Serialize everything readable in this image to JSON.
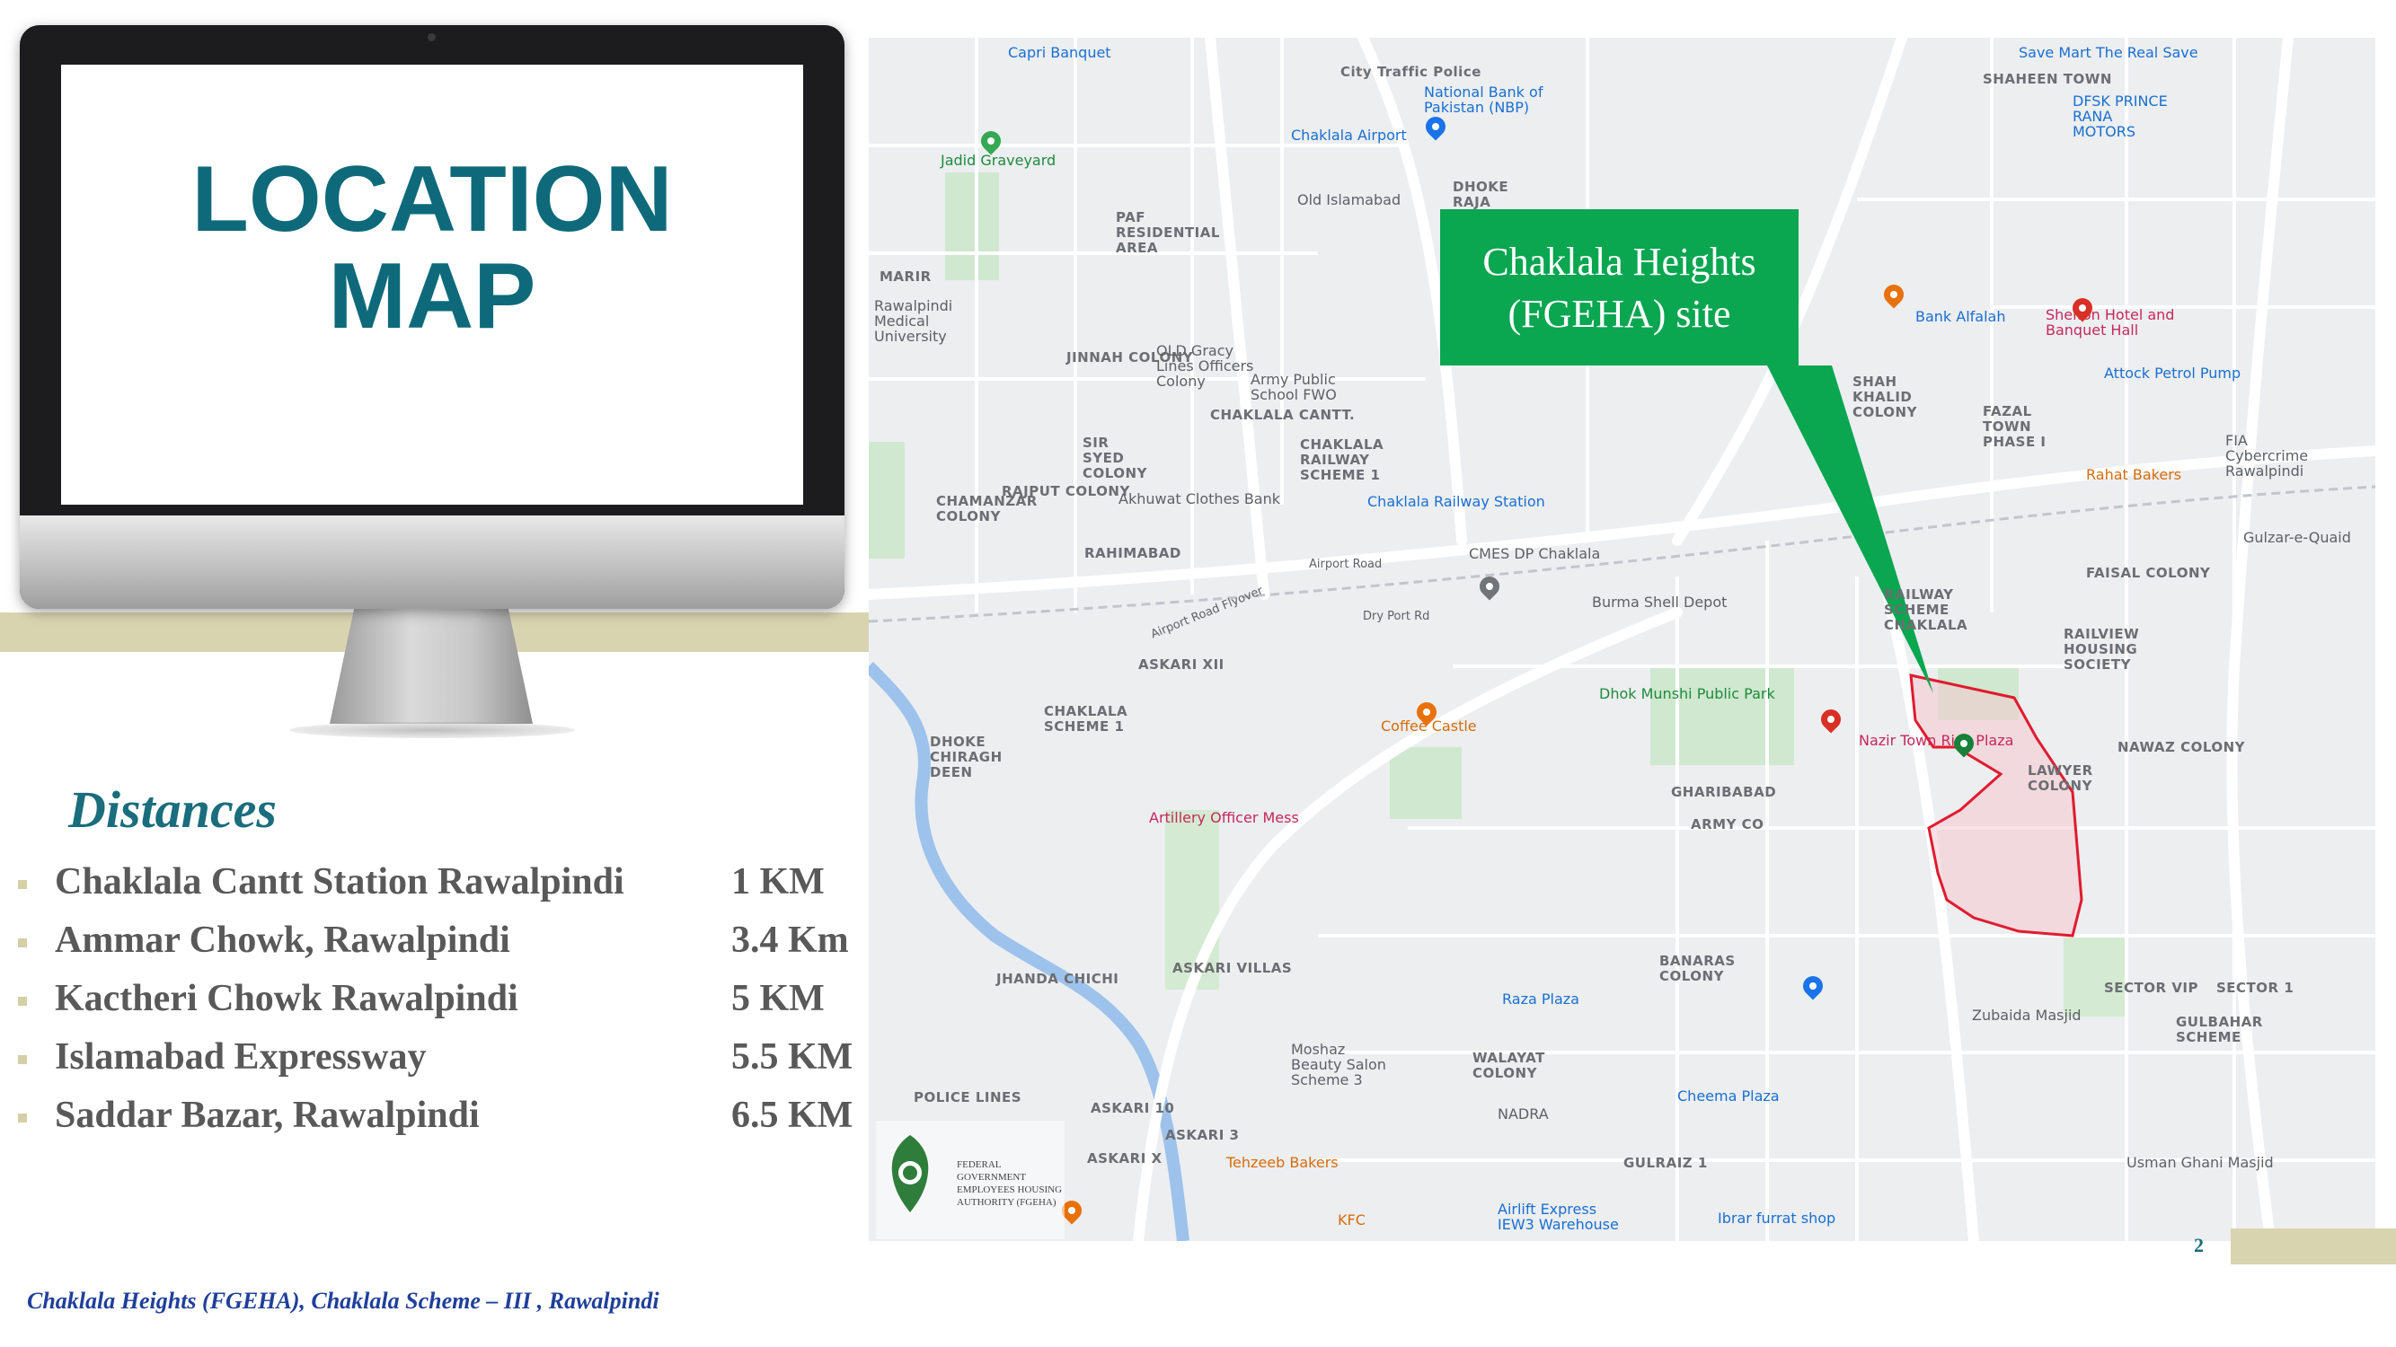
{
  "title_line1": "LOCATION",
  "title_line2": "MAP",
  "distances_heading": "Distances",
  "distances": [
    {
      "place": "Chaklala Cantt Station Rawalpindi",
      "distance": "1 KM"
    },
    {
      "place": "Ammar Chowk, Rawalpindi",
      "distance": "3.4 Km"
    },
    {
      "place": "Kactheri Chowk Rawalpindi",
      "distance": "5 KM"
    },
    {
      "place": "Islamabad Expressway",
      "distance": "5.5 KM"
    },
    {
      "place": "Saddar Bazar, Rawalpindi",
      "distance": "6.5 KM"
    }
  ],
  "footer": "Chaklala Heights (FGEHA), Chaklala Scheme – III , Rawalpindi",
  "page_number": "2",
  "callout": {
    "line1": "Chaklala Heights",
    "line2": "(FGEHA) site"
  },
  "logo_text": "FEDERAL GOVERNMENT EMPLOYEES HOUSING AUTHORITY (FGEHA)",
  "colors": {
    "title": "#0e6a7a",
    "callout": "#0aa650",
    "accent_tan": "#d9d4b0",
    "footer": "#1f3f9a"
  },
  "map_labels": {
    "capri_banquet": "Capri Banquet",
    "city_traffic_police": "City Traffic Police",
    "national_bank": "National Bank of Pakistan (NBP)",
    "save_mart": "Save Mart The Real Save",
    "shaheen_town": "SHAHEEN TOWN",
    "dfsk": "DFSK PRINCE RANA MOTORS",
    "jadid_graveyard": "Jadid Graveyard",
    "chaklala_airport": "Chaklala Airport",
    "old_islamabad": "Old Islamabad",
    "dhoke_raja": "DHOKE RAJA MUHAMMAD",
    "paf_residential": "PAF RESIDENTIAL AREA",
    "marir": "MARIR",
    "rawalpindi_medical": "Rawalpindi Medical University",
    "jinnah_colony": "JINNAH COLONY",
    "old_gracy": "OLD Gracy Lines Officers Colony",
    "army_public_school": "Army Public School FWO",
    "chaklala_cantt": "CHAKLALA CANTT.",
    "chaklala_railway": "CHAKLALA RAILWAY SCHEME 1",
    "bank_alfalah": "Bank Alfalah",
    "shelton": "Shelton Hotel and Banquet Hall",
    "shah_khalid": "SHAH KHALID COLONY",
    "attock_petrol": "Attock Petrol Pump",
    "fazal_town": "FAZAL TOWN PHASE I",
    "sir_syed": "SIR SYED COLONY",
    "rajput_colony": "RAJPUT COLONY",
    "akhuwat": "Akhuwat Clothes Bank",
    "chaklala_station": "Chaklala Railway Station",
    "rahat_bakers": "Rahat Bakers",
    "fia": "FIA Cybercrime Rawalpindi",
    "chamanzar": "CHAMANZAR COLONY",
    "rahimabad": "RAHIMABAD",
    "cmes": "CMES DP Chaklala",
    "airport_road": "Airport Road",
    "airport_flyover": "Airport Road Flyover",
    "dry_port": "Dry Port Rd",
    "burma_shell": "Burma Shell Depot",
    "railway_scheme": "RAILWAY SCHEME CHAKLALA",
    "faisal_colony": "FAISAL COLONY",
    "gulzar_quaid": "Gulzar-e-Quaid",
    "askari_xii": "ASKARI XII",
    "chaklala_scheme_1": "CHAKLALA SCHEME 1",
    "dhoke_chiragh": "DHOKE CHIRAGH DEEN",
    "coffee_castle": "Coffee Castle",
    "dhok_munshi": "Dhok Munshi Public Park",
    "nazir_town": "Nazir Town Riaz Plaza",
    "railview": "RAILVIEW HOUSING SOCIETY",
    "nawaz_colony": "NAWAZ COLONY",
    "lawyer_colony": "LAWYER COLONY",
    "artillery": "Artillery Officer Mess",
    "gharibabad": "GHARIBABAD",
    "army_co": "ARMY CO",
    "askari_villas": "ASKARI VILLAS",
    "jhanda_chichi": "JHANDA CHICHI",
    "banaras": "BANARAS COLONY",
    "zubaida": "Zubaida Masjid",
    "sector_vip": "SECTOR VIP",
    "sector_1": "SECTOR 1",
    "gulbahar": "GULBAHAR SCHEME",
    "raza_plaza": "Raza Plaza",
    "moshaz": "Moshaz Beauty Salon Scheme 3",
    "walayat": "WALAYAT COLONY",
    "nadra": "NADRA",
    "cheema_plaza": "Cheema Plaza",
    "police_lines": "POLICE LINES",
    "askari_10": "ASKARI 10",
    "askari_x": "ASKARI X",
    "askari_3": "ASKARI 3",
    "tehzeeb": "Tehzeeb Bakers",
    "kfc": "KFC",
    "airlift": "Airlift Express IEW3 Warehouse",
    "gulraiz": "GULRAIZ 1",
    "ibrar": "Ibrar furrat shop",
    "usman_ghani": "Usman Ghani Masjid"
  }
}
